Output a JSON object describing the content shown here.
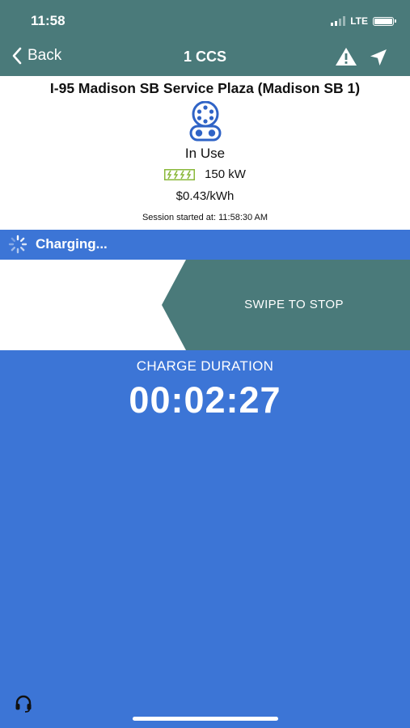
{
  "status_bar": {
    "time": "11:58",
    "network": "LTE"
  },
  "nav": {
    "back_label": "Back",
    "title": "1 CCS",
    "icons": [
      "chevron-left-icon",
      "warning-icon",
      "navigate-arrow-icon"
    ]
  },
  "station": {
    "name": "I-95 Madison SB Service Plaza (Madison SB 1)",
    "connector_icon": "ccs-connector-icon",
    "status": "In Use",
    "power": "150 kW",
    "power_icon": "charge-speed-icon",
    "price": "$0.43/kWh",
    "session_label": "Session started at:",
    "session_time": "11:58:30 AM"
  },
  "charging": {
    "icon": "spinner-icon",
    "label": "Charging..."
  },
  "swipe": {
    "label": "SWIPE TO STOP"
  },
  "duration": {
    "label": "CHARGE DURATION",
    "value": "00:02:27"
  },
  "footer": {
    "support_icon": "headset-icon"
  },
  "colors": {
    "header": "#4a7a7a",
    "accent_blue": "#3c75d6",
    "white": "#ffffff",
    "connector_blue": "#2f63c6",
    "power_green": "#8ab83a"
  }
}
